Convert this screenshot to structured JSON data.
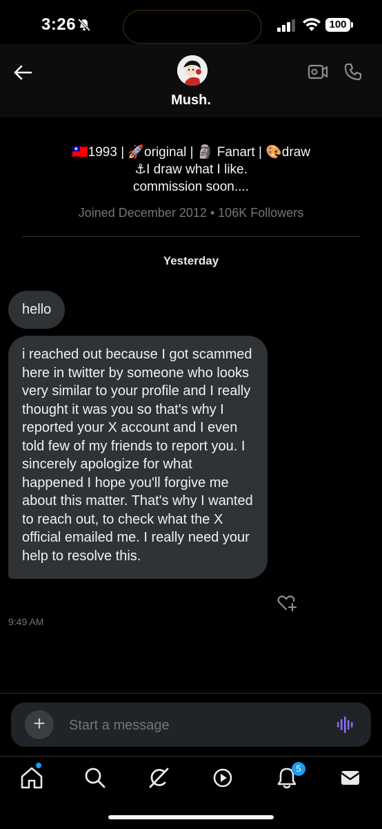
{
  "status_bar": {
    "time": "3:26",
    "battery": "100",
    "icons": [
      "bell-slash-icon",
      "signal-icon",
      "wifi-icon",
      "battery-icon"
    ]
  },
  "header": {
    "contact_name": "Mush.",
    "icons": [
      "back-arrow-icon",
      "video-call-icon",
      "phone-icon"
    ]
  },
  "profile": {
    "bio_line1": "🇹🇼1993 | 🚀original | 🗿 Fanart | 🎨draw",
    "bio_line2": "⚓I draw what I like.",
    "bio_line3": "commission soon....",
    "joined": "Joined December 2012 • 106K Followers"
  },
  "conversation": {
    "date_separator": "Yesterday",
    "messages": [
      {
        "text": "hello"
      },
      {
        "text": "i  reached out because I got scammed here in twitter by someone who looks very similar to your profile and I really thought it was you so that's why I reported your X account and I even told few of my friends to report you. I sincerely apologize for what happened I hope you'll forgive me about this matter. That's why I wanted to reach out, to check what the X official emailed me. I really need your help to resolve this."
      }
    ],
    "timestamp": "9:49 AM"
  },
  "composer": {
    "placeholder": "Start a message",
    "plus": "+"
  },
  "tab_bar": {
    "notifications_badge": "5",
    "items": [
      "home-icon",
      "search-icon",
      "grok-icon",
      "video-icon",
      "notifications-icon",
      "messages-icon"
    ]
  },
  "colors": {
    "background": "#000000",
    "bubble": "#2f3336",
    "muted_text": "#71767b",
    "accent": "#1d9bf0",
    "voice_accent": "#8b6cf6"
  }
}
